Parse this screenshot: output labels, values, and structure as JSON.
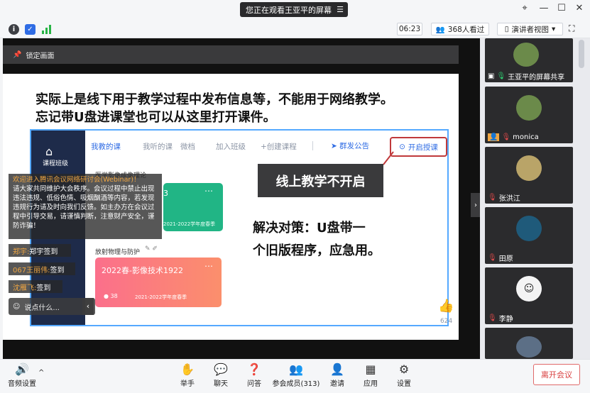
{
  "titlebar": {
    "title": "您正在观看王亚平的屏幕",
    "menu_icon": "menu-icon"
  },
  "toolbar": {
    "time": "06:23",
    "viewers": "368人看过",
    "view_mode": "演讲者视图"
  },
  "share": {
    "lock_label": "锁定画面",
    "slide_line1": "实际上是线下用于教学过程中发布信息等，不能用于网络教学。",
    "slide_line2": "忘记带U盘进课堂也可以从这里打开课件。",
    "sidebar_label": "课程班级",
    "tabs": [
      "我教的课",
      "我听的课",
      "微档",
      "加入班级",
      "+创建课程"
    ],
    "publish": "群发公告",
    "start": "开启授课",
    "callout": "线上教学不开启",
    "solution_line1": "解决对策：U盘带一",
    "solution_line2": "个旧版程序，应急用。",
    "card1_section": "医学影像成像理论",
    "card1_num": "023",
    "card1_sub": "2021-2022学年度春季",
    "card2_section": "放射物理与防护",
    "card2_title": "2022春-影像技术1922",
    "card2_count": "38",
    "card2_sub": "2021-2022学年度春季",
    "like_count": "624"
  },
  "chat": {
    "welcome_title": "欢迎进入腾讯会议网络研讨会(Webinar)！",
    "welcome_body": "请大家共同维护大会秩序。会议过程中禁止出现违法违规、低俗色情、吸烟酗酒等内容，若发现违规行为请及时向我们反馈。如主办方在会议过程中引导交易，请谨慎判断，注意财产安全，谨防诈骗！",
    "lines": [
      {
        "name": "郑宇:",
        "text": "郑宇签到"
      },
      {
        "name": "067王丽伟:",
        "text": "签到"
      },
      {
        "name": "沈雁飞:",
        "text": "签到"
      }
    ],
    "input_placeholder": "说点什么..."
  },
  "participants": [
    {
      "name": "王亚平的屏幕共享",
      "mic": "mic-on",
      "color": "#4a6b3c"
    },
    {
      "name": "monica",
      "mic": "mic-off",
      "color": "#6b8a4a"
    },
    {
      "name": "张洪江",
      "mic": "mic-off",
      "color": "#b9a468"
    },
    {
      "name": "田原",
      "mic": "mic-off",
      "color": "#1f5a7a"
    },
    {
      "name": "李静",
      "mic": "mic-off",
      "color": "#3a3a3c"
    }
  ],
  "bottombar": {
    "audio": "音频设置",
    "items": [
      "举手",
      "聊天",
      "问答",
      "参会成员(313)",
      "邀请",
      "应用",
      "设置"
    ],
    "leave": "离开会议"
  },
  "colors": {
    "accent": "#2f6ce4",
    "alert": "#c0393b",
    "green_card": "#21b585",
    "pink_card": "#fb7a7a"
  }
}
